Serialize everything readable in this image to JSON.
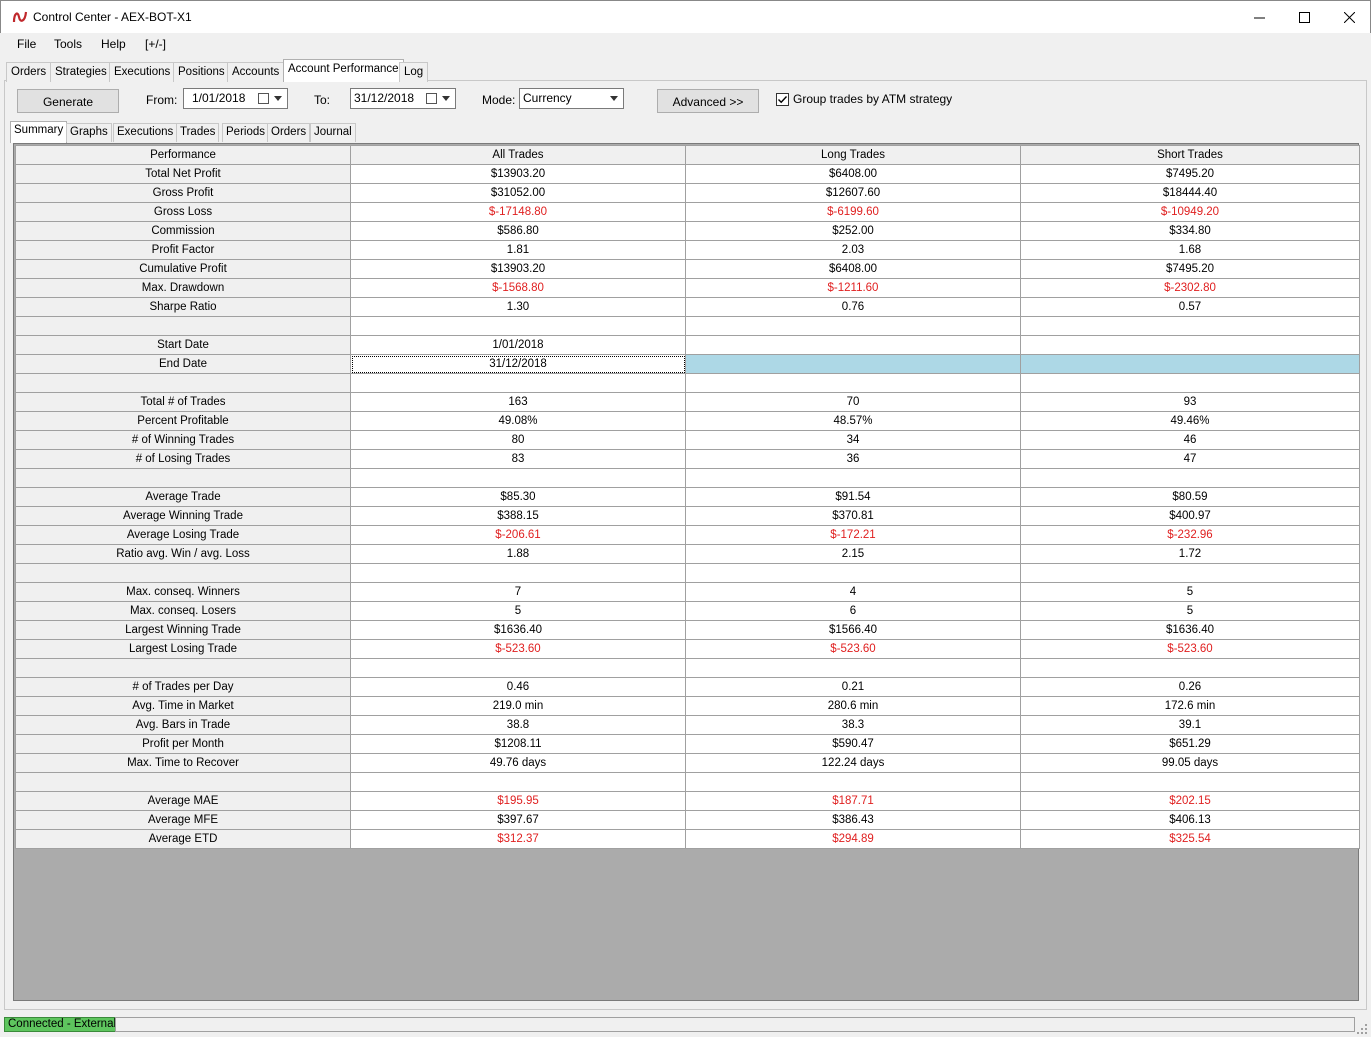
{
  "window": {
    "title": "Control Center - AEX-BOT-X1",
    "icon": "ninjatrader-logo-icon",
    "controls": [
      "minimize-icon",
      "maximize-icon",
      "close-icon"
    ]
  },
  "menu": {
    "file": "File",
    "tools": "Tools",
    "help": "Help",
    "toggle": "[+/-]"
  },
  "top_tabs": {
    "orders": "Orders",
    "strategies": "Strategies",
    "executions": "Executions",
    "positions": "Positions",
    "accounts": "Accounts",
    "account_performance": "Account Performance",
    "log": "Log",
    "active": "Account Performance"
  },
  "toolbar": {
    "generate": "Generate",
    "from_label": "From:",
    "from_value": "1/01/2018",
    "to_label": "To:",
    "to_value": "31/12/2018",
    "mode_label": "Mode:",
    "mode_value": "Currency",
    "advanced": "Advanced >>",
    "group_trades_label": "Group trades by ATM strategy",
    "group_trades_checked": true
  },
  "sub_tabs": {
    "summary": "Summary",
    "graphs": "Graphs",
    "executions": "Executions",
    "trades": "Trades",
    "periods": "Periods",
    "orders": "Orders",
    "journal": "Journal",
    "active": "Summary"
  },
  "table": {
    "columns": [
      "Performance",
      "All Trades",
      "Long Trades",
      "Short Trades"
    ],
    "rows": [
      {
        "label": "Total Net Profit",
        "all": "$13903.20",
        "long": "$6408.00",
        "short": "$7495.20"
      },
      {
        "label": "Gross Profit",
        "all": "$31052.00",
        "long": "$12607.60",
        "short": "$18444.40"
      },
      {
        "label": "Gross Loss",
        "all": "$-17148.80",
        "long": "$-6199.60",
        "short": "$-10949.20",
        "negative": true
      },
      {
        "label": "Commission",
        "all": "$586.80",
        "long": "$252.00",
        "short": "$334.80"
      },
      {
        "label": "Profit Factor",
        "all": "1.81",
        "long": "2.03",
        "short": "1.68"
      },
      {
        "label": "Cumulative Profit",
        "all": "$13903.20",
        "long": "$6408.00",
        "short": "$7495.20"
      },
      {
        "label": "Max. Drawdown",
        "all": "$-1568.80",
        "long": "$-1211.60",
        "short": "$-2302.80",
        "negative": true
      },
      {
        "label": "Sharpe Ratio",
        "all": "1.30",
        "long": "0.76",
        "short": "0.57"
      },
      {
        "label": "",
        "all": "",
        "long": "",
        "short": ""
      },
      {
        "label": "Start Date",
        "all": "1/01/2018",
        "long": "",
        "short": ""
      },
      {
        "label": "End Date",
        "all": "31/12/2018",
        "long": "",
        "short": "",
        "selected": true
      },
      {
        "label": "",
        "all": "",
        "long": "",
        "short": ""
      },
      {
        "label": "Total # of Trades",
        "all": "163",
        "long": "70",
        "short": "93"
      },
      {
        "label": "Percent Profitable",
        "all": "49.08%",
        "long": "48.57%",
        "short": "49.46%"
      },
      {
        "label": "# of Winning Trades",
        "all": "80",
        "long": "34",
        "short": "46"
      },
      {
        "label": "# of Losing Trades",
        "all": "83",
        "long": "36",
        "short": "47"
      },
      {
        "label": "",
        "all": "",
        "long": "",
        "short": ""
      },
      {
        "label": "Average Trade",
        "all": "$85.30",
        "long": "$91.54",
        "short": "$80.59"
      },
      {
        "label": "Average Winning Trade",
        "all": "$388.15",
        "long": "$370.81",
        "short": "$400.97"
      },
      {
        "label": "Average Losing Trade",
        "all": "$-206.61",
        "long": "$-172.21",
        "short": "$-232.96",
        "negative": true
      },
      {
        "label": "Ratio avg. Win / avg. Loss",
        "all": "1.88",
        "long": "2.15",
        "short": "1.72"
      },
      {
        "label": "",
        "all": "",
        "long": "",
        "short": ""
      },
      {
        "label": "Max. conseq. Winners",
        "all": "7",
        "long": "4",
        "short": "5"
      },
      {
        "label": "Max. conseq. Losers",
        "all": "5",
        "long": "6",
        "short": "5"
      },
      {
        "label": "Largest Winning Trade",
        "all": "$1636.40",
        "long": "$1566.40",
        "short": "$1636.40"
      },
      {
        "label": "Largest Losing Trade",
        "all": "$-523.60",
        "long": "$-523.60",
        "short": "$-523.60",
        "negative": true
      },
      {
        "label": "",
        "all": "",
        "long": "",
        "short": ""
      },
      {
        "label": "# of Trades per Day",
        "all": "0.46",
        "long": "0.21",
        "short": "0.26"
      },
      {
        "label": "Avg. Time in Market",
        "all": "219.0 min",
        "long": "280.6 min",
        "short": "172.6 min"
      },
      {
        "label": "Avg. Bars in Trade",
        "all": "38.8",
        "long": "38.3",
        "short": "39.1"
      },
      {
        "label": "Profit per Month",
        "all": "$1208.11",
        "long": "$590.47",
        "short": "$651.29"
      },
      {
        "label": "Max. Time to Recover",
        "all": "49.76 days",
        "long": "122.24 days",
        "short": "99.05 days"
      },
      {
        "label": "",
        "all": "",
        "long": "",
        "short": ""
      },
      {
        "label": "Average MAE",
        "all": "$195.95",
        "long": "$187.71",
        "short": "$202.15",
        "negative": true
      },
      {
        "label": "Average MFE",
        "all": "$397.67",
        "long": "$386.43",
        "short": "$406.13"
      },
      {
        "label": "Average ETD",
        "all": "$312.37",
        "long": "$294.89",
        "short": "$325.54",
        "negative": true
      }
    ]
  },
  "status": {
    "connection": "Connected - External",
    "connection_color": "#5ec55e",
    "negative_color": "#e02020",
    "selection_color": "#add8e6"
  }
}
